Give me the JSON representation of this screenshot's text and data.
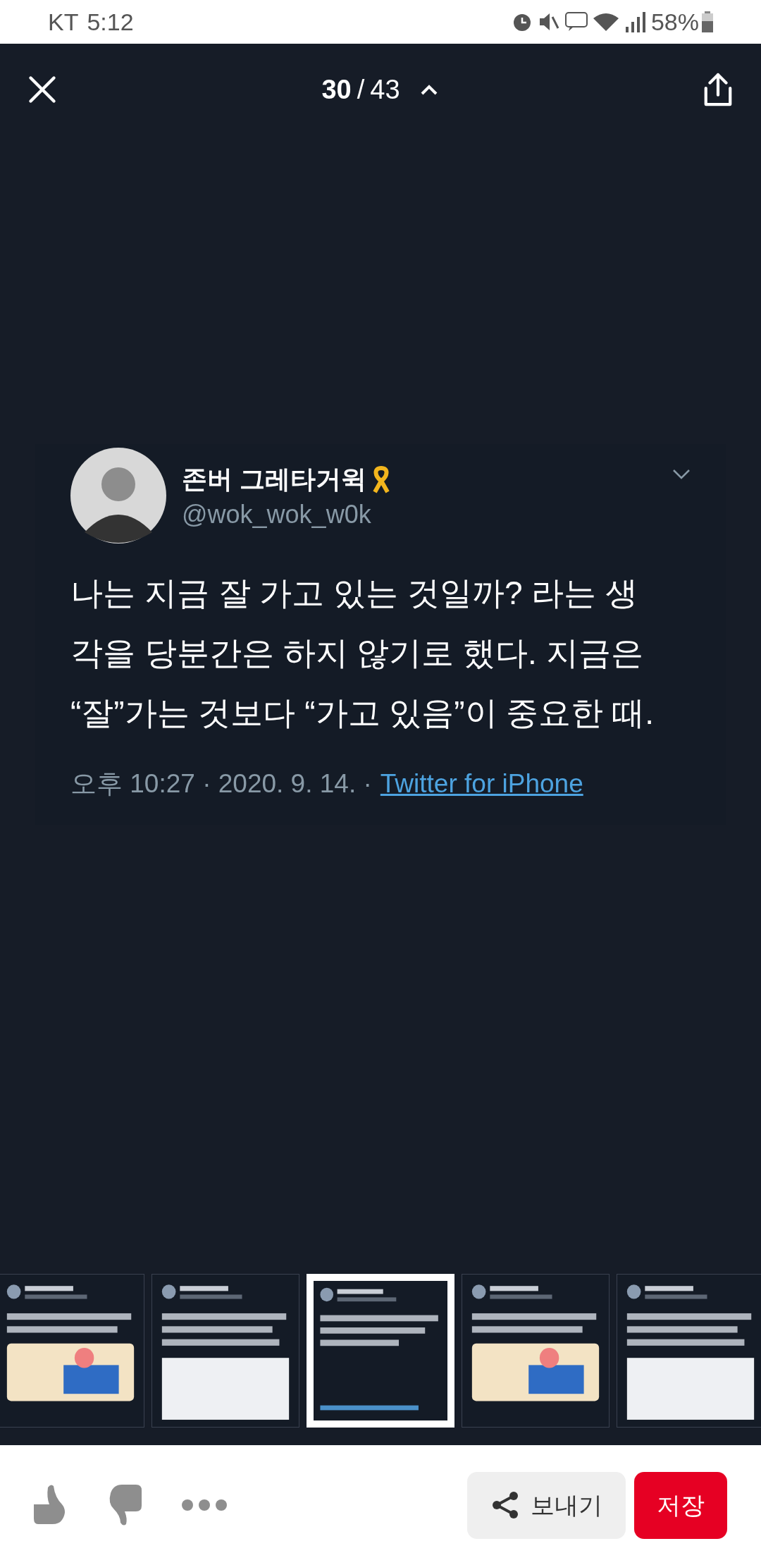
{
  "status_bar": {
    "carrier": "KT",
    "time": "5:12",
    "battery": "58%"
  },
  "top_bar": {
    "counter": {
      "current": "30",
      "separator": "/",
      "total": "43"
    }
  },
  "tweet": {
    "display_name": "존버 그레타거윅",
    "handle": "@wok_wok_w0k",
    "text": "나는 지금 잘 가고 있는 것일까? 라는 생각을 당분간은 하지 않기로 했다. 지금은 “잘”가는 것보다 “가고 있음”이 중요한 때.",
    "meta": "오후 10:27 · 2020. 9. 14. ·",
    "source": "Twitter for iPhone"
  },
  "thumbnails": [
    {
      "kind": "picture",
      "selected": false
    },
    {
      "kind": "picture",
      "selected": false
    },
    {
      "kind": "picture",
      "selected": true
    },
    {
      "kind": "picture",
      "selected": false
    },
    {
      "kind": "picture",
      "selected": false
    }
  ],
  "actions": {
    "share_label": "보내기",
    "save_label": "저장"
  }
}
